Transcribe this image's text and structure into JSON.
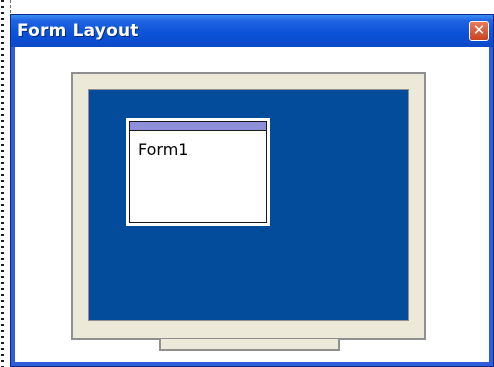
{
  "window": {
    "title": "Form Layout",
    "close_glyph": "✕",
    "titlebar_color": "#0a52d8",
    "close_color": "#d4552f"
  },
  "monitor": {
    "screen_color": "#034c9b",
    "frame_color": "#ece9d8"
  },
  "form_preview": {
    "label": "Form1",
    "title_color": "#8d8fd8"
  }
}
